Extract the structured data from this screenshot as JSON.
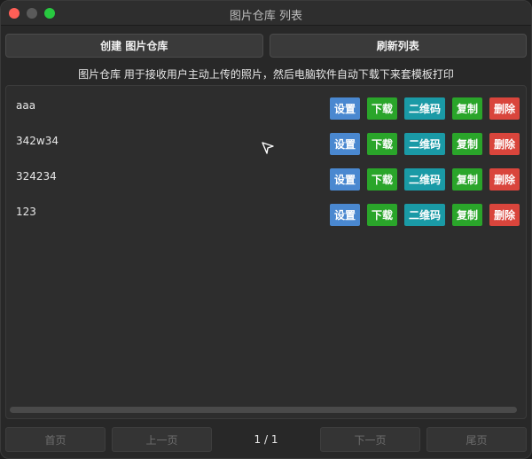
{
  "window": {
    "title": "图片仓库 列表"
  },
  "toolbar": {
    "create_label": "创建 图片仓库",
    "refresh_label": "刷新列表"
  },
  "description": "图片仓库 用于接收用户主动上传的照片，然后电脑软件自动下载下来套模板打印",
  "row_actions": {
    "settings": "设置",
    "download": "下载",
    "qrcode": "二维码",
    "copy": "复制",
    "delete": "删除"
  },
  "repos": [
    {
      "name": "aaa"
    },
    {
      "name": "342w34"
    },
    {
      "name": "324234"
    },
    {
      "name": "123"
    }
  ],
  "pagination": {
    "first": "首页",
    "prev": "上一页",
    "info": "1 / 1",
    "next": "下一页",
    "last": "尾页"
  },
  "colors": {
    "settings": "#4a88d0",
    "download": "#2aa52a",
    "qrcode": "#1a9aa6",
    "copy": "#2aa52a",
    "delete": "#d9453c"
  }
}
